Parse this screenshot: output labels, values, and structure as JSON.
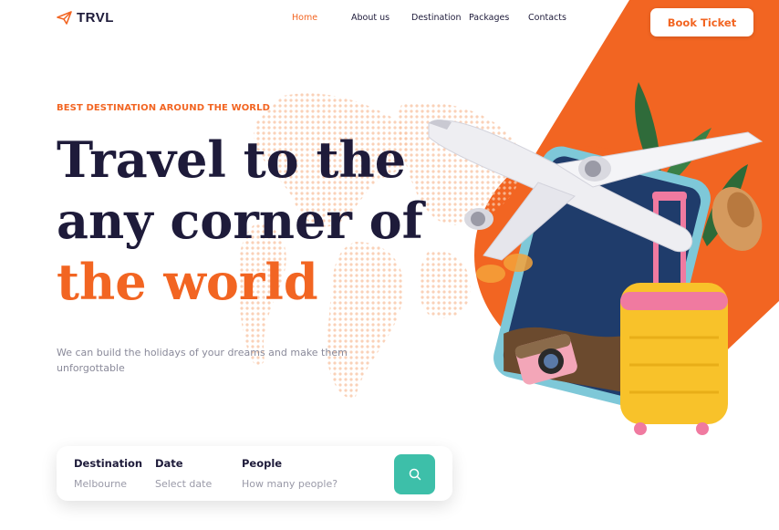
{
  "brand": {
    "name": "TRVL",
    "icon": "paper-plane-icon"
  },
  "nav": {
    "items": [
      {
        "label": "Home",
        "active": true
      },
      {
        "label": "About us",
        "active": false
      },
      {
        "label": "Destination",
        "active": false
      },
      {
        "label": "Packages",
        "active": false
      },
      {
        "label": "Contacts",
        "active": false
      }
    ],
    "cta_label": "Book Ticket"
  },
  "hero": {
    "eyebrow": "BEST DESTINATION AROUND THE WORLD",
    "line1": "Travel to the",
    "line2": "any corner of",
    "line3": "the world",
    "subtitle": "We can build the holidays of your dreams and make them unforgottable"
  },
  "search": {
    "fields": [
      {
        "label": "Destination",
        "value": "Melbourne"
      },
      {
        "label": "Date",
        "value": "Select date"
      },
      {
        "label": "People",
        "value": "How many people?"
      }
    ],
    "button_icon": "search-icon"
  },
  "colors": {
    "accent": "#f26522",
    "dark": "#1e1b3a",
    "teal": "#3dbfa9",
    "muted": "#8a8a9a"
  }
}
